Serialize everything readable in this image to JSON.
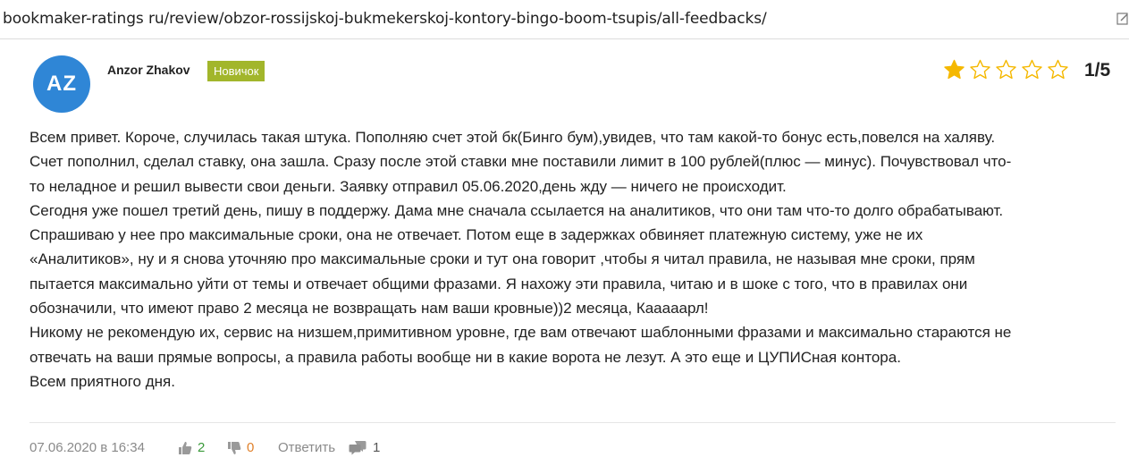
{
  "browser": {
    "url": "bookmaker-ratings ru/review/obzor-rossijskoj-bukmekerskoj-kontory-bingo-boom-tsupis/all-feedbacks/"
  },
  "review": {
    "avatar_initials": "AZ",
    "author": "Anzor Zhakov",
    "badge": "Новичок",
    "rating": {
      "value": 1,
      "max": 5,
      "label": "1/5"
    },
    "lines": [
      "Всем привет. Короче, случилась такая штука. Пополняю счет этой бк(Бинго бум),увидев, что там какой-то бонус есть,повелся на халяву.",
      "Счет пополнил, сделал ставку, она зашла. Сразу после этой ставки мне поставили лимит в 100 рублей(плюс — минус). Почувствовал что-",
      "то неладное и решил вывести свои деньги. Заявку отправил 05.06.2020,день жду — ничего не происходит.",
      "Сегодня уже пошел третий день, пишу в поддержу. Дама мне сначала ссылается на аналитиков, что они там что-то долго обрабатывают.",
      "Спрашиваю у нее про максимальные сроки, она не отвечает. Потом еще в задержках обвиняет платежную систему, уже не их",
      "«Аналитиков», ну и я снова уточняю про максимальные сроки и тут она говорит ,чтобы я читал правила, не называя мне сроки, прям",
      "пытается максимально уйти от темы и отвечает общими фразами. Я нахожу эти правила, читаю и в шоке с того, что в правилах они",
      "обозначили, что имеют право 2 месяца не возвращать нам ваши кровные))2 месяца, Кааааарл!",
      "Никому не рекомендую их, сервис на низшем,примитивном уровне, где вам отвечают шаблонными фразами и максимально стараются не",
      "отвечать на ваши прямые вопросы, а правила работы вообще ни в какие ворота не лезут. А это еще и ЦУПИСная контора.",
      "Всем приятного дня."
    ],
    "footer": {
      "date": "07.06.2020 в 16:34",
      "likes": "2",
      "dislikes": "0",
      "reply_label": "Ответить",
      "comments": "1"
    },
    "colors": {
      "avatar": "#2f86d6",
      "badge": "#a2b62b",
      "star": "#f5b800",
      "likes": "#3a9a3a",
      "dislikes": "#e0812b"
    }
  }
}
